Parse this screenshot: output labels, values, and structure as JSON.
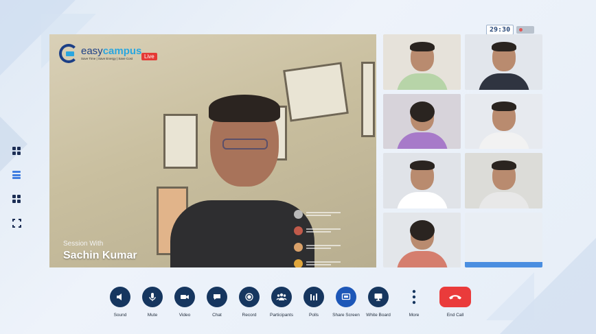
{
  "timer": "29:30",
  "brand": {
    "name_plain": "easy",
    "name_bold": "campus",
    "tagline": "Save Time | Save Energy | Save Cost",
    "live_label": "Live"
  },
  "session": {
    "label": "Session With",
    "speaker": "Sachin Kumar"
  },
  "controls": [
    {
      "label": "Sound",
      "icon": "speaker-icon"
    },
    {
      "label": "Mute",
      "icon": "microphone-icon"
    },
    {
      "label": "Video",
      "icon": "video-camera-icon"
    },
    {
      "label": "Chat",
      "icon": "chat-bubble-icon"
    },
    {
      "label": "Record",
      "icon": "record-icon"
    },
    {
      "label": "Participants",
      "icon": "people-icon"
    },
    {
      "label": "Polls",
      "icon": "poll-bars-icon"
    },
    {
      "label": "Share Screen",
      "icon": "share-screen-icon"
    },
    {
      "label": "White Board",
      "icon": "monitor-icon"
    },
    {
      "label": "More",
      "icon": "more-vertical-icon"
    },
    {
      "label": "End Call",
      "icon": "hang-up-icon"
    }
  ],
  "side_rail": [
    "grid-view-icon",
    "list-view-icon",
    "tile-view-icon",
    "fullscreen-icon"
  ],
  "colors": {
    "control_bg": "#16365f",
    "share_active": "#1d57b8",
    "end_call": "#ea3b3b",
    "live_badge": "#e53935"
  }
}
